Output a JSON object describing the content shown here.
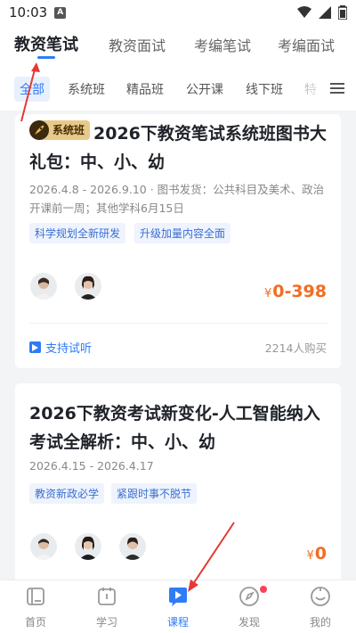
{
  "status": {
    "time": "10:03",
    "notif": "A"
  },
  "top_tabs": [
    {
      "label": "教资笔试"
    },
    {
      "label": "教资面试"
    },
    {
      "label": "考编笔试"
    },
    {
      "label": "考编面试"
    }
  ],
  "categories": [
    "全部",
    "系统班",
    "精品班",
    "公开课",
    "线下班",
    "特"
  ],
  "courses": [
    {
      "badge": "系统班",
      "title": "2026下教资笔试系统班图书大礼包：中、小、幼",
      "meta": "2026.4.8 - 2026.9.10 · 图书发货：公共科目及美术、政治开课前一周；其他学科6月15日",
      "tags": [
        "科学规划全新研发",
        "升级加量内容全面"
      ],
      "currency": "¥",
      "price": "0-398",
      "trial": "支持试听",
      "buyers": "2214人购买"
    },
    {
      "title": "2026下教资考试新变化-人工智能纳入考试全解析：中、小、幼",
      "meta": "2026.4.15 - 2026.4.17",
      "tags": [
        "教资新政必学",
        "紧跟时事不脱节"
      ],
      "currency": "¥",
      "price": "0"
    }
  ],
  "bottom_nav": [
    {
      "label": "首页",
      "icon": "home-book-icon"
    },
    {
      "label": "学习",
      "icon": "study-icon"
    },
    {
      "label": "课程",
      "icon": "course-play-icon"
    },
    {
      "label": "发现",
      "icon": "discover-compass-icon"
    },
    {
      "label": "我的",
      "icon": "profile-smile-icon"
    }
  ],
  "colors": {
    "accent": "#2f7cf6",
    "price": "#f36c22",
    "annotation": "#e53935"
  }
}
